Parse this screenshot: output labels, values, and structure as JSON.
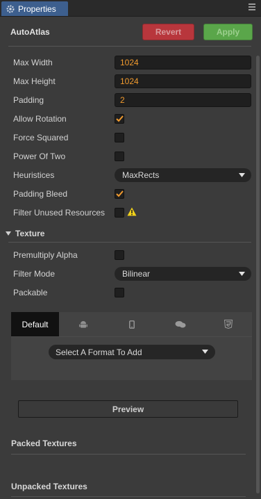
{
  "tab": {
    "title": "Properties",
    "icon": "gear-icon"
  },
  "header": {
    "title": "AutoAtlas",
    "revert_label": "Revert",
    "apply_label": "Apply"
  },
  "fields": {
    "max_width": {
      "label": "Max Width",
      "value": "1024"
    },
    "max_height": {
      "label": "Max Height",
      "value": "1024"
    },
    "padding": {
      "label": "Padding",
      "value": "2"
    },
    "allow_rotation": {
      "label": "Allow Rotation",
      "checked": true
    },
    "force_squared": {
      "label": "Force Squared",
      "checked": false
    },
    "power_of_two": {
      "label": "Power Of Two",
      "checked": false
    },
    "heuristices": {
      "label": "Heuristices",
      "value": "MaxRects"
    },
    "padding_bleed": {
      "label": "Padding Bleed",
      "checked": true
    },
    "filter_unused": {
      "label": "Filter Unused Resources",
      "checked": false
    }
  },
  "texture": {
    "title": "Texture",
    "premultiply_alpha": {
      "label": "Premultiply Alpha",
      "checked": false
    },
    "filter_mode": {
      "label": "Filter Mode",
      "value": "Bilinear"
    },
    "packable": {
      "label": "Packable",
      "checked": false
    }
  },
  "platforms": {
    "tabs": [
      "Default",
      "android-icon",
      "phone-icon",
      "chat-icon",
      "html5-icon"
    ],
    "format_placeholder": "Select A Format To Add"
  },
  "preview_label": "Preview",
  "packed_title": "Packed Textures",
  "unpacked_title": "Unpacked Textures",
  "colors": {
    "accent_tab": "#3d5f8e",
    "revert": "#b8363c",
    "apply": "#5aa64a",
    "value_text": "#f09a2e"
  }
}
